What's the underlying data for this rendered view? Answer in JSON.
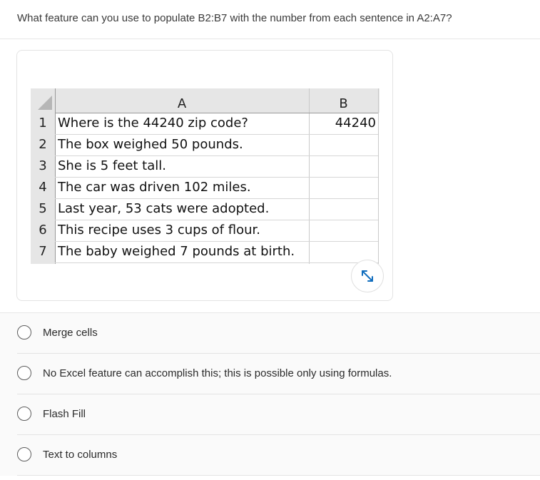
{
  "question": "What feature can you use to populate B2:B7 with the number from each sentence in A2:A7?",
  "spreadsheet": {
    "columns": [
      "A",
      "B"
    ],
    "rows": [
      {
        "num": "1",
        "a": "Where is the 44240 zip code?",
        "b": "44240"
      },
      {
        "num": "2",
        "a": "The box weighed 50 pounds.",
        "b": ""
      },
      {
        "num": "3",
        "a": "She is 5 feet tall.",
        "b": ""
      },
      {
        "num": "4",
        "a": "The car was driven 102 miles.",
        "b": ""
      },
      {
        "num": "5",
        "a": "Last year, 53 cats were adopted.",
        "b": ""
      },
      {
        "num": "6",
        "a": "This recipe uses 3 cups of flour.",
        "b": ""
      },
      {
        "num": "7",
        "a": "The baby weighed 7 pounds at birth.",
        "b": ""
      }
    ]
  },
  "expand_icon": "expand-arrows-icon",
  "options": [
    {
      "label": "Merge cells"
    },
    {
      "label": "No Excel feature can accomplish this; this is possible only using formulas."
    },
    {
      "label": "Flash Fill"
    },
    {
      "label": "Text to columns"
    }
  ],
  "colors": {
    "accent": "#0f6cbd",
    "header_gray": "#e6e6e6"
  }
}
